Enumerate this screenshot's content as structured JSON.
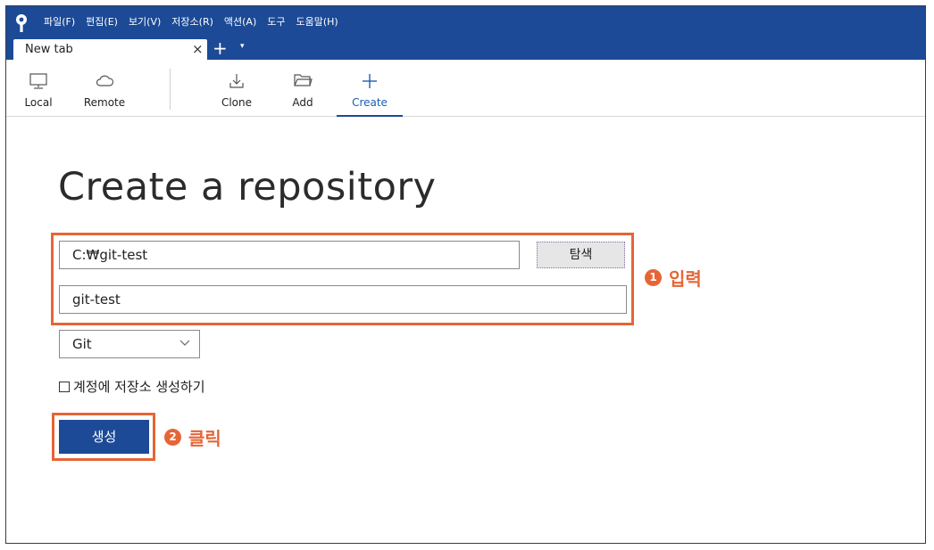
{
  "menu": [
    "파일(F)",
    "편집(E)",
    "보기(V)",
    "저장소(R)",
    "액션(A)",
    "도구",
    "도움말(H)"
  ],
  "tab": {
    "label": "New tab",
    "close": "×",
    "add": "+",
    "menu": "▾"
  },
  "toolbar": {
    "local": "Local",
    "remote": "Remote",
    "clone": "Clone",
    "add": "Add",
    "create": "Create"
  },
  "form": {
    "title": "Create a repository",
    "path_value": "C:₩git-test",
    "browse_label": "탐색",
    "name_value": "git-test",
    "vcs_selected": "Git",
    "account_checkbox_label": "계정에 저장소 생성하기",
    "create_label": "생성"
  },
  "annotations": [
    {
      "num": "1",
      "text": "입력"
    },
    {
      "num": "2",
      "text": "클릭"
    }
  ],
  "colors": {
    "titlebar": "#1c4a96",
    "highlight": "#e66537",
    "primary_button": "#1c4a96"
  }
}
